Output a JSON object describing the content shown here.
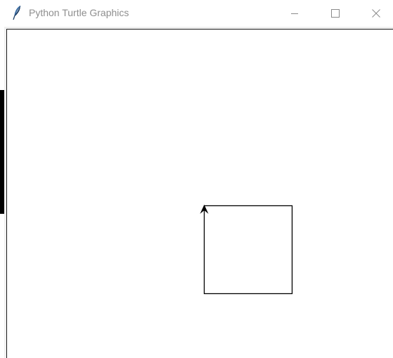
{
  "window": {
    "title": "Python Turtle Graphics",
    "app_icon": "feather-icon",
    "controls": {
      "minimize_icon": "minimize-icon",
      "maximize_icon": "maximize-icon",
      "close_icon": "close-icon"
    }
  },
  "canvas": {
    "background": "#ffffff",
    "pen_color": "#000000",
    "shape": "square",
    "turtle_heading": "up",
    "turtle_icon": "turtle-arrow-icon"
  }
}
